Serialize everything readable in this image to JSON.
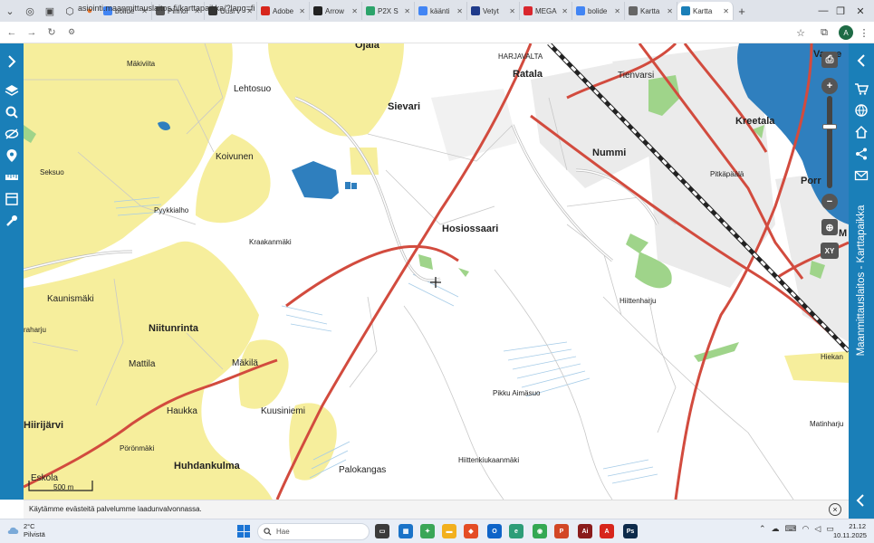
{
  "browser": {
    "tabs": [
      {
        "label": "bolide",
        "favicon": "google-icon",
        "color": "#4285f4"
      },
      {
        "label": "Pinnoi",
        "favicon": "pinterest-icon",
        "color": "#555555"
      },
      {
        "label": "Uusi v",
        "favicon": "news-icon",
        "color": "#333333"
      },
      {
        "label": "Adobe",
        "favicon": "adobe-icon",
        "color": "#d7261c"
      },
      {
        "label": "Arrow",
        "favicon": "arrow-icon",
        "color": "#222222"
      },
      {
        "label": "P2X S",
        "favicon": "p2x-icon",
        "color": "#2ba36a"
      },
      {
        "label": "käänti",
        "favicon": "google-icon",
        "color": "#4285f4"
      },
      {
        "label": "Vetyt",
        "favicon": "vety-icon",
        "color": "#1e3a8a"
      },
      {
        "label": "MEGA",
        "favicon": "mega-icon",
        "color": "#d9272e"
      },
      {
        "label": "bolide",
        "favicon": "google-icon",
        "color": "#4285f4"
      },
      {
        "label": "Kartta",
        "favicon": "kartta-icon",
        "color": "#666666"
      },
      {
        "label": "Kartta",
        "favicon": "kartta-icon",
        "color": "#1a7fb8",
        "active": true
      }
    ],
    "new_tab": "+",
    "url": "asiointi.maanmittauslaitos.fi/karttapaikka/?lang=fi",
    "avatar_letter": "A"
  },
  "map": {
    "service_title": "Maanmittauslaitos - Karttapaikka",
    "scale_label": "500 m",
    "place_names": [
      {
        "text": "Ojala",
        "style": "big"
      },
      {
        "text": "HARJAVALTA",
        "style": "sm"
      },
      {
        "text": "Ratala",
        "style": "big"
      },
      {
        "text": "Tienvarsi",
        "style": "med"
      },
      {
        "text": "Vasse",
        "style": "big"
      },
      {
        "text": "Mäkiviita",
        "style": "sm"
      },
      {
        "text": "Lehtosuo",
        "style": "med"
      },
      {
        "text": "Sievari",
        "style": "big"
      },
      {
        "text": "Kreetala",
        "style": "big"
      },
      {
        "text": "Koivunen",
        "style": "med"
      },
      {
        "text": "Nummi",
        "style": "big"
      },
      {
        "text": "Seksuo",
        "style": "sm"
      },
      {
        "text": "Pitkäpäälä",
        "style": "sm"
      },
      {
        "text": "Porr",
        "style": "big"
      },
      {
        "text": "Pyykkialho",
        "style": "sm"
      },
      {
        "text": "Hosiossaari",
        "style": "big"
      },
      {
        "text": "Kraakanmäki",
        "style": "sm"
      },
      {
        "text": "M",
        "style": "big"
      },
      {
        "text": "Kaunismäki",
        "style": "med"
      },
      {
        "text": "Hiittenharju",
        "style": "sm"
      },
      {
        "text": "Niitunrinta",
        "style": "big"
      },
      {
        "text": "raharju",
        "style": "sm"
      },
      {
        "text": "Mattila",
        "style": "med"
      },
      {
        "text": "Mäkilä",
        "style": "med"
      },
      {
        "text": "Hiekan",
        "style": "sm"
      },
      {
        "text": "Pikku Aimäsuo",
        "style": "sm"
      },
      {
        "text": "Hiirijärvi",
        "style": "big"
      },
      {
        "text": "Haukka",
        "style": "med"
      },
      {
        "text": "Kuusiniemi",
        "style": "med"
      },
      {
        "text": "Matinharju",
        "style": "sm"
      },
      {
        "text": "Pörönmäki",
        "style": "sm"
      },
      {
        "text": "Huhdankulma",
        "style": "big"
      },
      {
        "text": "Hiittenkiukaanmäki",
        "style": "sm"
      },
      {
        "text": "Eskola",
        "style": "med"
      },
      {
        "text": "Palokangas",
        "style": "med"
      }
    ],
    "controls": {
      "zoom_in": "+",
      "zoom_out": "−",
      "locate": "locate-icon",
      "coordinates": "XY"
    }
  },
  "cookie_notice": {
    "text": "Käytämme evästeitä palvelumme laadunvalvonnassa.",
    "close": "×"
  },
  "taskbar": {
    "temperature": "2°C",
    "weather": "Pilvistä",
    "search_placeholder": "Hae",
    "time": "21.12",
    "date": "10.11.2025"
  }
}
